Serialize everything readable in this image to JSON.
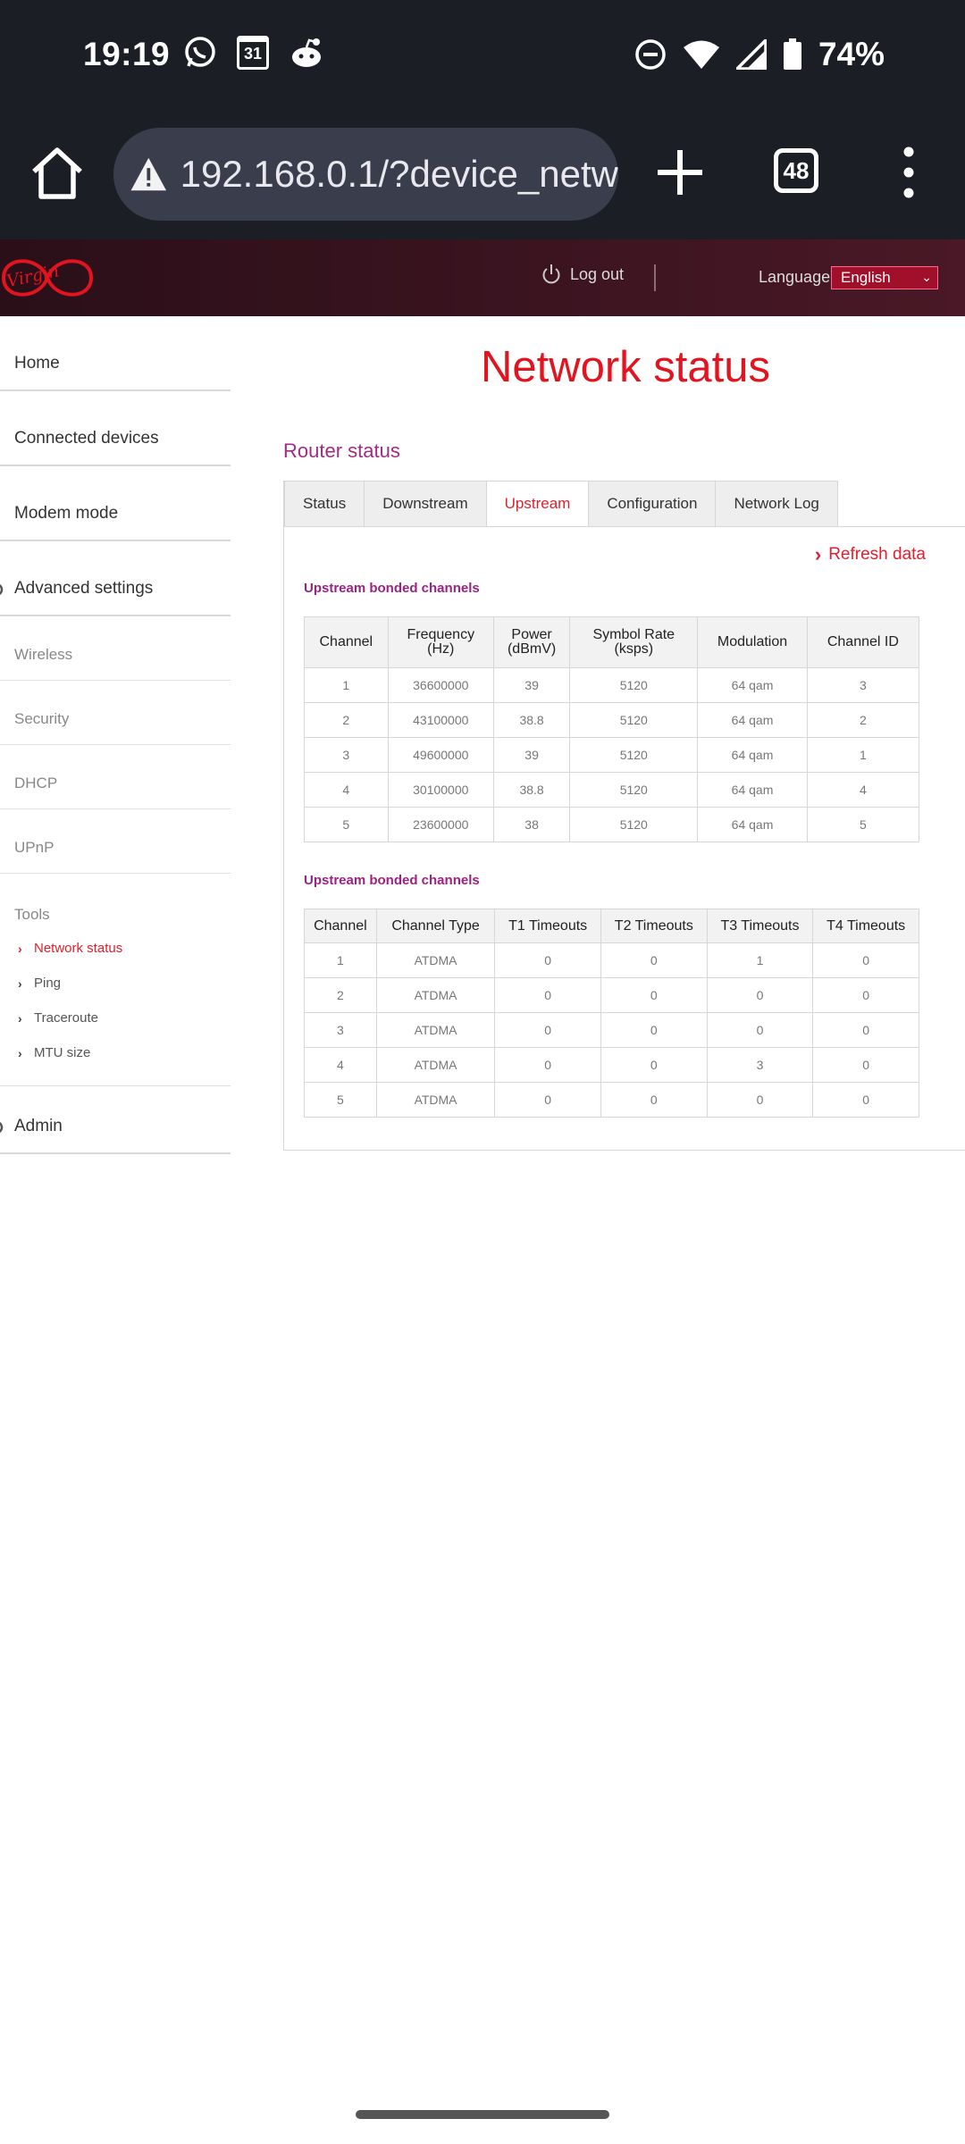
{
  "status_bar": {
    "time": "19:19",
    "calendar_date": "31",
    "battery_percent": "74%"
  },
  "browser": {
    "url": "192.168.0.1/?device_netw",
    "tab_count": "48"
  },
  "header": {
    "logo_text": "Virgin",
    "logout_label": "Log out",
    "language_label": "Language",
    "language_value": "English"
  },
  "sidebar": {
    "main_items": [
      {
        "label": "Home"
      },
      {
        "label": "Connected devices"
      },
      {
        "label": "Modem mode"
      },
      {
        "label": "Advanced settings"
      }
    ],
    "sub_items": [
      {
        "label": "Wireless"
      },
      {
        "label": "Security"
      },
      {
        "label": "DHCP"
      },
      {
        "label": "UPnP"
      }
    ],
    "tools_heading": "Tools",
    "tools": [
      {
        "label": "Network status",
        "active": true
      },
      {
        "label": "Ping"
      },
      {
        "label": "Traceroute"
      },
      {
        "label": "MTU size"
      }
    ],
    "admin_label": "Admin"
  },
  "main": {
    "page_title": "Network status",
    "section_title": "Router status",
    "tabs": [
      "Status",
      "Downstream",
      "Upstream",
      "Configuration",
      "Network Log"
    ],
    "active_tab": "Upstream",
    "refresh_label": "Refresh data",
    "table1": {
      "caption": "Upstream bonded channels",
      "headers": [
        [
          "Channel"
        ],
        [
          "Frequency",
          "(Hz)"
        ],
        [
          "Power",
          "(dBmV)"
        ],
        [
          "Symbol Rate",
          "(ksps)"
        ],
        [
          "Modulation"
        ],
        [
          "Channel ID"
        ]
      ],
      "rows": [
        [
          "1",
          "36600000",
          "39",
          "5120",
          "64 qam",
          "3"
        ],
        [
          "2",
          "43100000",
          "38.8",
          "5120",
          "64 qam",
          "2"
        ],
        [
          "3",
          "49600000",
          "39",
          "5120",
          "64 qam",
          "1"
        ],
        [
          "4",
          "30100000",
          "38.8",
          "5120",
          "64 qam",
          "4"
        ],
        [
          "5",
          "23600000",
          "38",
          "5120",
          "64 qam",
          "5"
        ]
      ]
    },
    "table2": {
      "caption": "Upstream bonded channels",
      "headers": [
        "Channel",
        "Channel Type",
        "T1 Timeouts",
        "T2 Timeouts",
        "T3 Timeouts",
        "T4 Timeouts"
      ],
      "rows": [
        [
          "1",
          "ATDMA",
          "0",
          "0",
          "1",
          "0"
        ],
        [
          "2",
          "ATDMA",
          "0",
          "0",
          "0",
          "0"
        ],
        [
          "3",
          "ATDMA",
          "0",
          "0",
          "0",
          "0"
        ],
        [
          "4",
          "ATDMA",
          "0",
          "0",
          "3",
          "0"
        ],
        [
          "5",
          "ATDMA",
          "0",
          "0",
          "0",
          "0"
        ]
      ]
    }
  },
  "colors": {
    "brand_red": "#e1141f",
    "section_purple": "#a22b84",
    "header_bg": "#3b1420",
    "chrome_bg": "#1c1e26"
  }
}
